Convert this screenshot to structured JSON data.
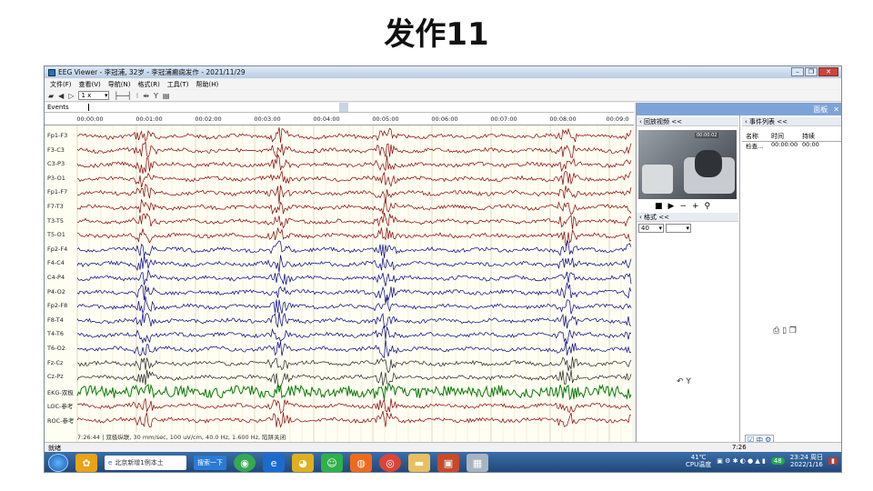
{
  "slide": {
    "title": "发作11"
  },
  "window": {
    "title": "EEG Viewer - 李冠浦, 32岁 - 李冠浦癫痫发作 - 2021/11/29",
    "controls": {
      "minimize": "–",
      "restore": "❐",
      "close": "✕"
    }
  },
  "menu": [
    "文件(F)",
    "查看(V)",
    "导航(N)",
    "格式(R)",
    "工具(T)",
    "帮助(H)"
  ],
  "toolbar": {
    "speed": "1 x"
  },
  "events_label": "Events",
  "time_ticks": [
    "00:00:00",
    "00:01:00",
    "00:02:00",
    "00:03:00",
    "00:04:00",
    "00:05:00",
    "00:06:00",
    "00:07:00",
    "00:08:00",
    "00:09:0"
  ],
  "channels": [
    {
      "label": "Fp1-F3",
      "color": "#8b0000"
    },
    {
      "label": "F3-C3",
      "color": "#8b0000"
    },
    {
      "label": "C3-P3",
      "color": "#8b0000"
    },
    {
      "label": "P3-O1",
      "color": "#8b0000"
    },
    {
      "label": "Fp1-F7",
      "color": "#8b0000"
    },
    {
      "label": "F7-T3",
      "color": "#8b0000"
    },
    {
      "label": "T3-T5",
      "color": "#8b0000"
    },
    {
      "label": "T5-O1",
      "color": "#8b0000"
    },
    {
      "label": "Fp2-F4",
      "color": "#00008b"
    },
    {
      "label": "F4-C4",
      "color": "#00008b"
    },
    {
      "label": "C4-P4",
      "color": "#00008b"
    },
    {
      "label": "P4-O2",
      "color": "#00008b"
    },
    {
      "label": "Fp2-F8",
      "color": "#00008b"
    },
    {
      "label": "F8-T4",
      "color": "#00008b"
    },
    {
      "label": "T4-T6",
      "color": "#00008b"
    },
    {
      "label": "T6-O2",
      "color": "#00008b"
    },
    {
      "label": "Fz-Cz",
      "color": "#222222"
    },
    {
      "label": "Cz-Pz",
      "color": "#222222"
    },
    {
      "label": "EKG-双极",
      "color": "#0a7a0a"
    },
    {
      "label": "LOC-参考",
      "color": "#8b0000"
    },
    {
      "label": "ROC-参考",
      "color": "#8b0000"
    }
  ],
  "footer_info": "7:26:44 | 双极纵联, 30 mm/sec, 100 uV/cm, 40.0 Hz, 1.600 Hz, 陷阱关闭",
  "status": {
    "left": "就绪",
    "time": "7:26"
  },
  "right_panel": {
    "header": "面板",
    "close": "✕",
    "video_section": "回放视频 <<",
    "video_stamp": "00:00:02",
    "format_section": "格式 <<",
    "format_value": "40",
    "events_section": "事件列表 <<",
    "event_columns": [
      "名称",
      "时间",
      "持续"
    ],
    "event_rows": [
      [
        "检查...",
        "00:00:00",
        "00:00"
      ]
    ]
  },
  "taskbar": {
    "search_text": "北京新增1例本土",
    "search_button": "搜索一下",
    "temp": "41℃",
    "temp_label": "CPU温度",
    "notif_count": "48",
    "clock_time": "23:24 周日",
    "clock_date": "2022/1/16"
  },
  "ime": [
    "中"
  ]
}
